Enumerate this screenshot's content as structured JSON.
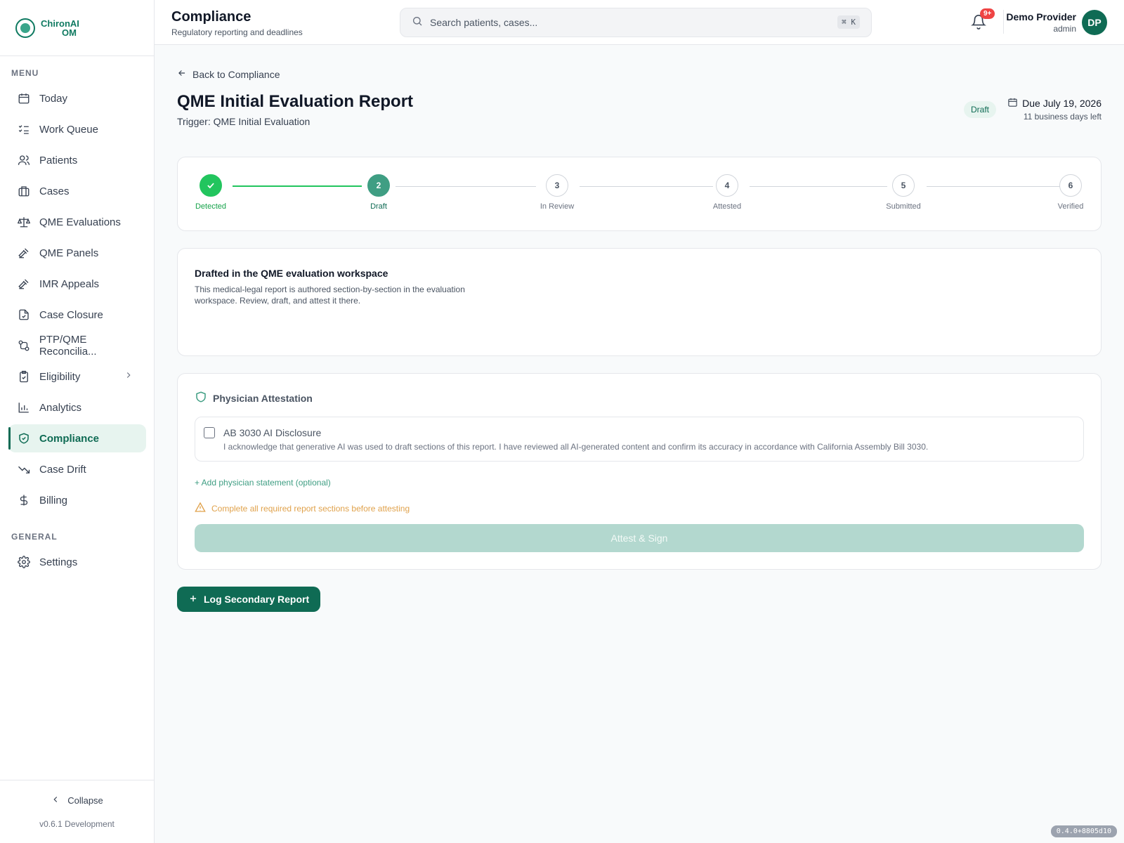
{
  "brand": {
    "line1": "ChironAI",
    "line2": "OM"
  },
  "sidebar": {
    "menu_label": "MENU",
    "items": [
      {
        "label": "Today",
        "icon": "calendar-icon"
      },
      {
        "label": "Work Queue",
        "icon": "list-checks-icon"
      },
      {
        "label": "Patients",
        "icon": "users-icon"
      },
      {
        "label": "Cases",
        "icon": "briefcase-icon"
      },
      {
        "label": "QME Evaluations",
        "icon": "scale-icon"
      },
      {
        "label": "QME Panels",
        "icon": "gavel-icon"
      },
      {
        "label": "IMR Appeals",
        "icon": "gavel-icon"
      },
      {
        "label": "Case Closure",
        "icon": "file-closed-icon"
      },
      {
        "label": "PTP/QME Reconcilia...",
        "icon": "git-compare-icon"
      },
      {
        "label": "Eligibility",
        "icon": "clipboard-check-icon"
      },
      {
        "label": "Analytics",
        "icon": "bar-chart-icon"
      },
      {
        "label": "Compliance",
        "icon": "shield-check-icon",
        "active": true
      },
      {
        "label": "Case Drift",
        "icon": "trending-down-icon"
      },
      {
        "label": "Billing",
        "icon": "dollar-icon"
      }
    ],
    "general_label": "GENERAL",
    "general_items": [
      {
        "label": "Settings",
        "icon": "gear-icon"
      }
    ],
    "collapse_label": "Collapse",
    "version": "v0.6.1 Development"
  },
  "header": {
    "title": "Compliance",
    "subtitle": "Regulatory reporting and deadlines",
    "search_placeholder": "Search patients, cases...",
    "shortcut": "⌘ K",
    "notifications_badge": "9+",
    "user_name": "Demo Provider",
    "user_role": "admin",
    "avatar_initials": "DP"
  },
  "page": {
    "back_label": "Back to Compliance",
    "title": "QME Initial Evaluation Report",
    "trigger": "Trigger: QME Initial Evaluation",
    "status": "Draft",
    "due": "Due July 19, 2026",
    "due_sub": "11 business days left"
  },
  "stepper": {
    "steps": [
      {
        "number": "",
        "label": "Detected",
        "state": "done"
      },
      {
        "number": "2",
        "label": "Draft",
        "state": "current"
      },
      {
        "number": "3",
        "label": "In Review",
        "state": "pending"
      },
      {
        "number": "4",
        "label": "Attested",
        "state": "pending"
      },
      {
        "number": "5",
        "label": "Submitted",
        "state": "pending"
      },
      {
        "number": "6",
        "label": "Verified",
        "state": "pending"
      }
    ]
  },
  "info": {
    "title": "Drafted in the QME evaluation workspace",
    "body": "This medical-legal report is authored section-by-section in the evaluation workspace. Review, draft, and attest it there."
  },
  "attestation": {
    "title": "Physician Attestation",
    "disclosure_title": "AB 3030 AI Disclosure",
    "disclosure_body": "I acknowledge that generative AI was used to draft sections of this report. I have reviewed all AI-generated content and confirm its accuracy in accordance with California Assembly Bill 3030.",
    "add_statement": "+ Add physician statement (optional)",
    "warning": "Complete all required report sections before attesting",
    "attest_button": "Attest & Sign"
  },
  "actions": {
    "log_secondary": "Log Secondary Report"
  },
  "build_tag": "0.4.0+8805d10",
  "colors": {
    "brand": "#0f6b54",
    "success": "#22c55e",
    "warning": "#e0a24c",
    "accent_light": "#e7f4ef"
  }
}
